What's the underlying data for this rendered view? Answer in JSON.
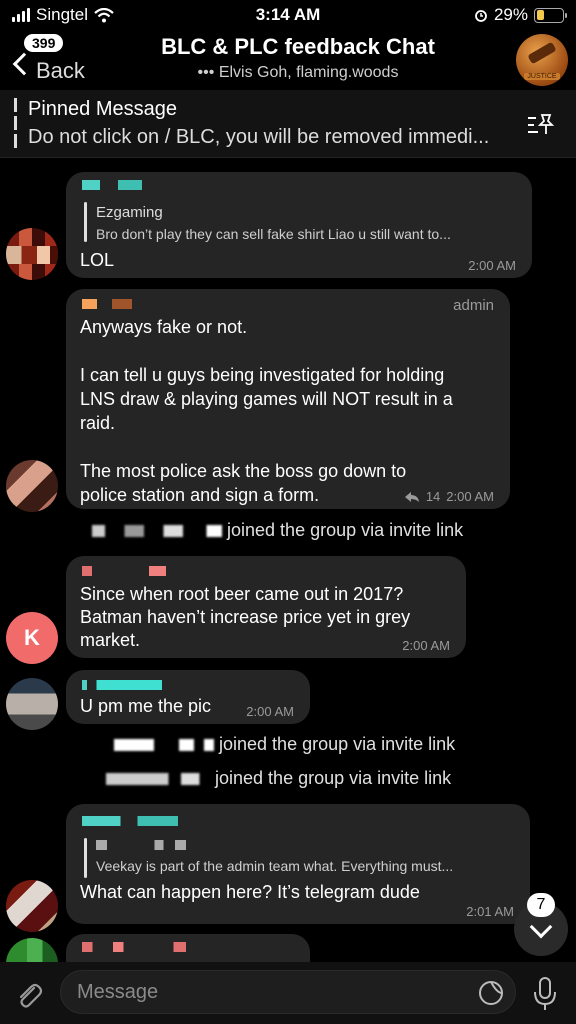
{
  "status": {
    "carrier": "Singtel",
    "time": "3:14 AM",
    "battery": "29%",
    "battery_level": 0.29,
    "battery_color": "#f2c94c"
  },
  "header": {
    "back_label": "Back",
    "unread": "399",
    "title": "BLC & PLC feedback Chat",
    "subtitle": "Elvis Goh, flaming.woods",
    "avatar_tag": "JUSTICE"
  },
  "pinned": {
    "title": "Pinned Message",
    "text": "Do not click on / BLC, you will be removed immedi..."
  },
  "messages": [
    {
      "reply_name": "Ezgaming",
      "reply_text": "Bro don’t play they can sell fake shirt Liao u still want to...",
      "text": "LOL",
      "time": "2:00 AM"
    },
    {
      "role": "admin",
      "lines": [
        "Anyways fake or not.",
        "",
        "I can tell u guys being investigated for holding",
        "LNS draw & playing games will NOT result in a",
        "raid.",
        "",
        "The most police ask the boss go down to",
        "police station and sign a form."
      ],
      "replies": "14",
      "time": "2:00 AM"
    },
    {
      "lines": [
        "Since when root beer came out in 2017?",
        "Batman haven’t increase price yet in grey",
        "market."
      ],
      "time": "2:00 AM",
      "avatar_letter": "K"
    },
    {
      "text": "U pm me the pic",
      "time": "2:00 AM"
    },
    {
      "reply_text": "Veekay is part of the admin team what. Everything must...",
      "text": "What can happen here? It’s telegram dude",
      "time": "2:01 AM"
    }
  ],
  "service": [
    {
      "text": "joined the group via invite link"
    },
    {
      "text": "joined the group via invite link"
    },
    {
      "text": "joined the group via invite link"
    }
  ],
  "scroll_down": {
    "count": "7"
  },
  "composer": {
    "placeholder": "Message"
  }
}
